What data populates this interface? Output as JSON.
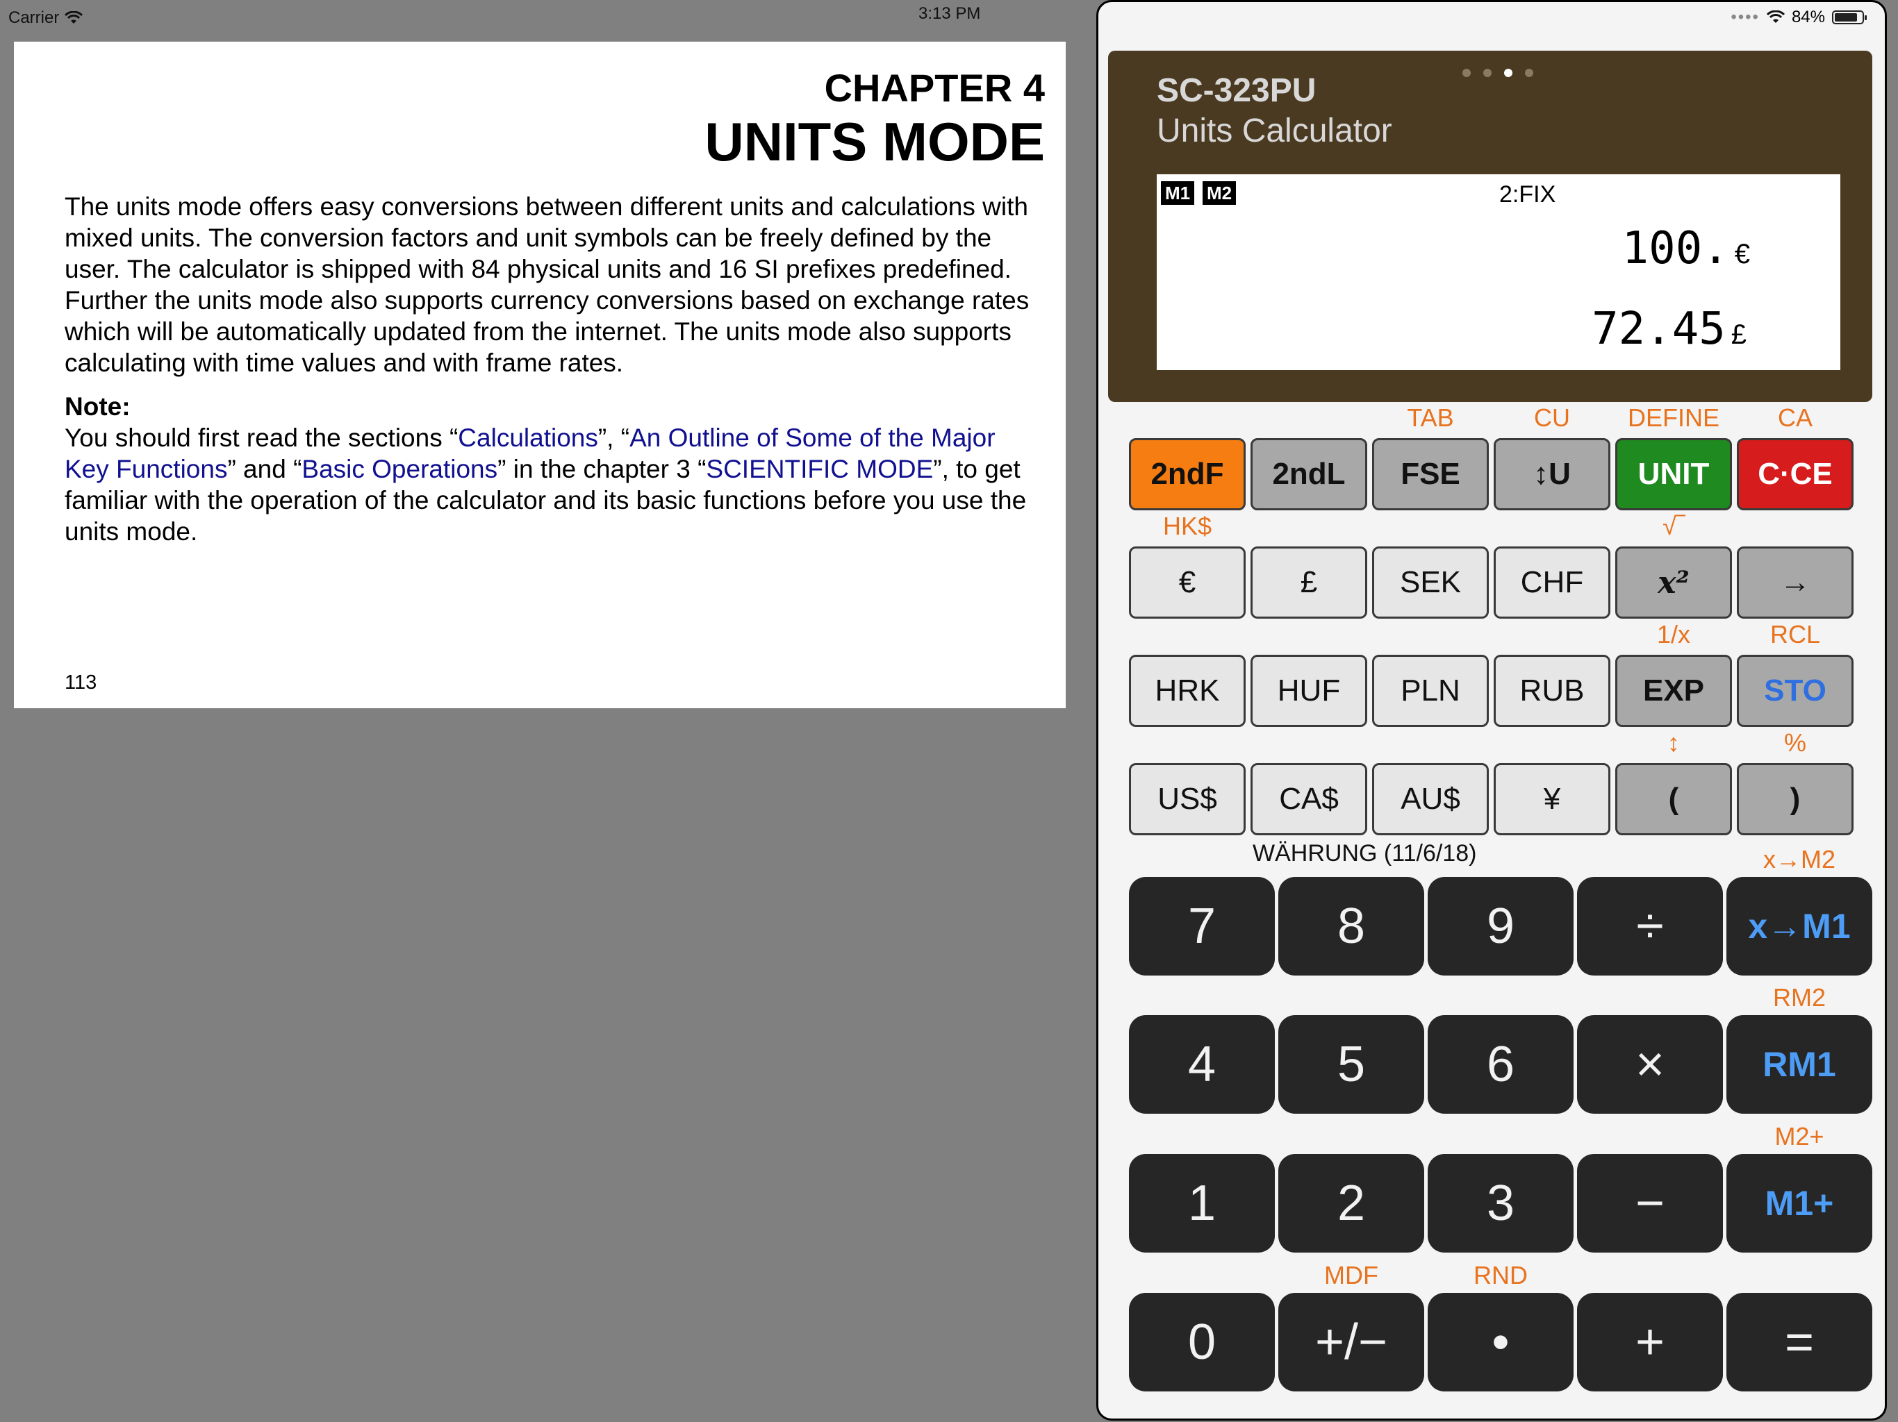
{
  "status_bar": {
    "carrier": "Carrier",
    "time": "3:13 PM",
    "battery": "84%",
    "battery_level": 0.84
  },
  "manual": {
    "chapter": "CHAPTER 4",
    "title": "UNITS MODE",
    "intro": "The units mode offers easy conversions between different units and calculations with mixed units. The conversion factors and unit symbols can be freely defined by the user. The calculator is shipped with 84 physical units and 16 SI prefixes predefined. Further the units mode also supports currency conversions based on exchange rates which will be automatically updated from the internet. The units mode also supports calculating with time values and with frame rates.",
    "note_heading": "Note:",
    "note": {
      "t1": "You should first read the sections “",
      "link1": "Calculations",
      "t2": "”, “",
      "link2": "An Outline of Some of the Major Key Functions",
      "t3": "” and “",
      "link3": "Basic Operations",
      "t4": "” in the chapter 3 “",
      "link4": "SCIENTIFIC MODE",
      "t5": "”, to get familiar with the operation of the calculator and its basic functions before you use the units mode."
    },
    "page_number": "113"
  },
  "calculator": {
    "model": "SC-323PU",
    "subtitle": "Units Calculator",
    "page_dots": 4,
    "active_dot": 3,
    "display": {
      "m1": "M1",
      "m2": "M2",
      "mode": "2:FIX",
      "line1_value": "100.",
      "line1_unit": "€",
      "line2_value": "72.45",
      "line2_unit": "£"
    },
    "row1": {
      "labels": [
        "",
        "",
        "TAB",
        "CU",
        "DEFINE",
        "CA"
      ],
      "keys": [
        "2ndF",
        "2ndL",
        "FSE",
        "↕U",
        "UNIT",
        "C·CE"
      ]
    },
    "row2": {
      "labels": [
        "HK$",
        "",
        "",
        "",
        "√‾",
        ""
      ],
      "keys": [
        "€",
        "£",
        "SEK",
        "CHF",
        "x²",
        "→"
      ]
    },
    "row3": {
      "labels": [
        "",
        "",
        "",
        "",
        "1/x",
        "RCL"
      ],
      "keys": [
        "HRK",
        "HUF",
        "PLN",
        "RUB",
        "EXP",
        "STO"
      ]
    },
    "row4": {
      "labels": [
        "",
        "",
        "",
        "",
        "↕",
        "%"
      ],
      "keys": [
        "US$",
        "CA$",
        "AU$",
        "¥",
        "(",
        ")"
      ]
    },
    "currency_label": "WÄHRUNG (11/6/18)",
    "numpad": {
      "r1": {
        "labels": [
          "",
          "",
          "",
          "",
          "x→M2"
        ],
        "keys": [
          "7",
          "8",
          "9",
          "÷",
          "x→M1"
        ]
      },
      "r2": {
        "labels": [
          "",
          "",
          "",
          "",
          "RM2"
        ],
        "keys": [
          "4",
          "5",
          "6",
          "×",
          "RM1"
        ]
      },
      "r3": {
        "labels": [
          "",
          "",
          "",
          "",
          "M2+"
        ],
        "keys": [
          "1",
          "2",
          "3",
          "−",
          "M1+"
        ]
      },
      "r4": {
        "labels": [
          "",
          "MDF",
          "RND",
          "",
          ""
        ],
        "keys": [
          "0",
          "+/−",
          "•",
          "+",
          "="
        ]
      }
    },
    "colors": {
      "orange": "#f57d12",
      "green": "#1f8a1f",
      "red": "#d61c1c",
      "blue": "#4d9cf5",
      "panel": "#4b3a22"
    }
  }
}
